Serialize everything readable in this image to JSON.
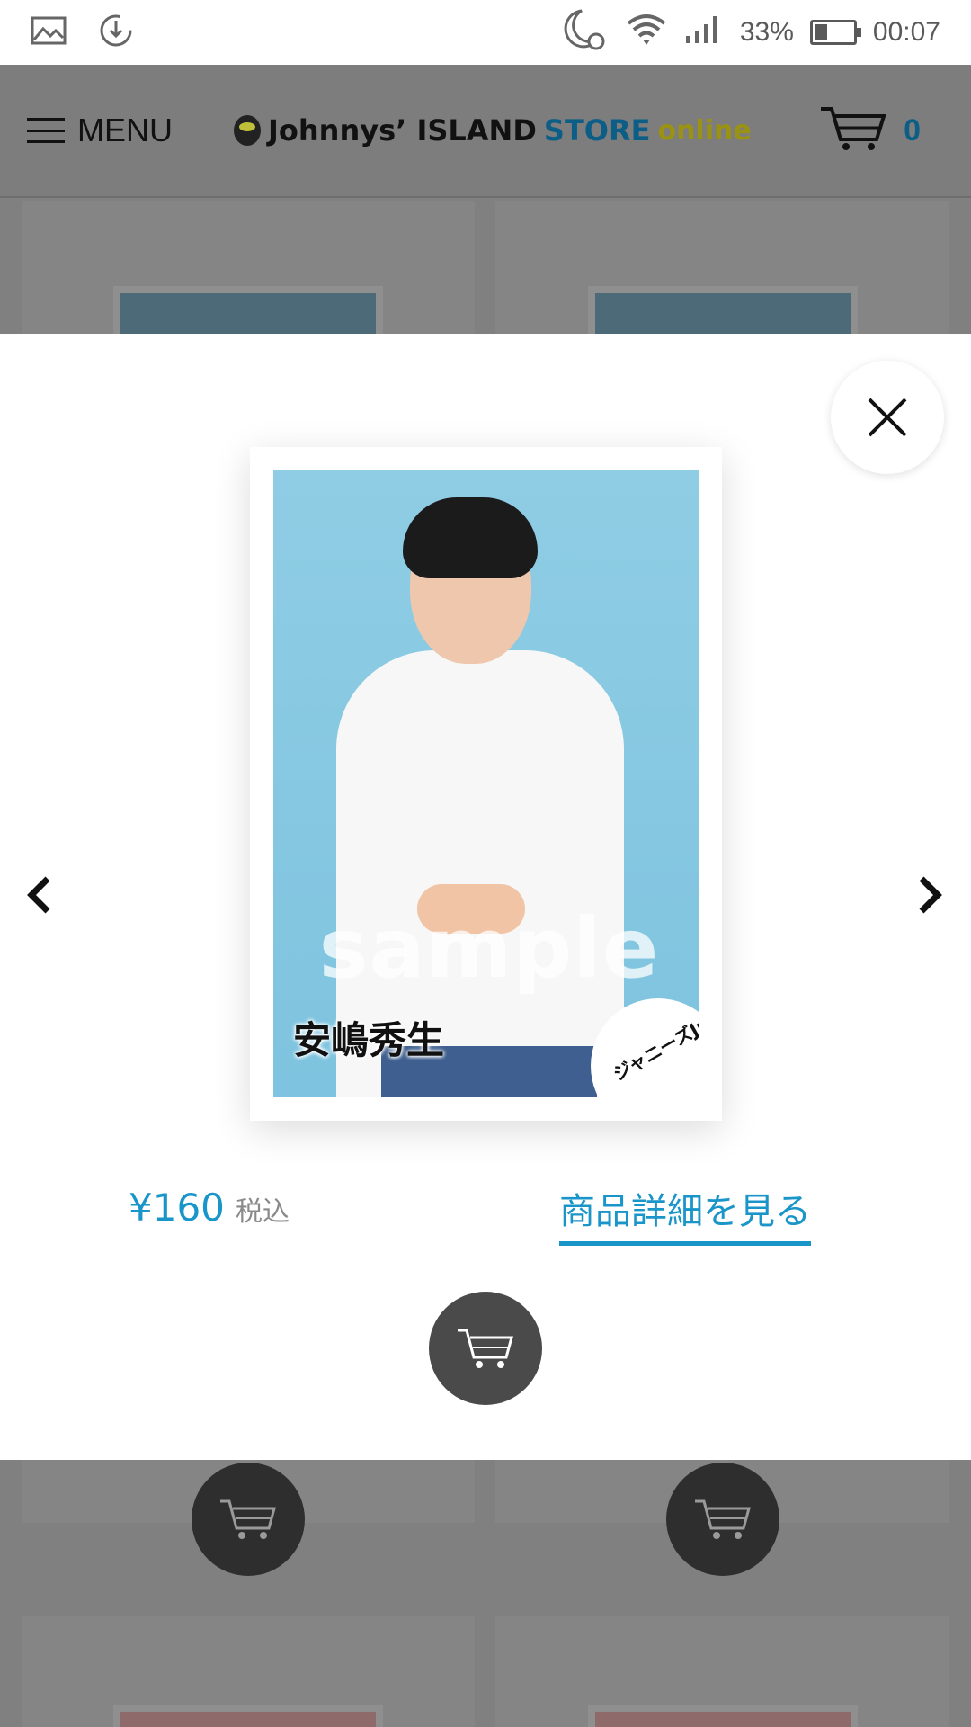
{
  "status_bar": {
    "battery": "33%",
    "battery_level": 0.33,
    "time": "00:07",
    "icons": [
      "gallery-icon",
      "sync-icon",
      "do-not-disturb-alarm-icon",
      "wifi-icon",
      "signal-icon",
      "battery-icon"
    ]
  },
  "header": {
    "menu_label": "MENU",
    "logo": {
      "part1": "Johnnys’ ISLAND",
      "part2": "STORE",
      "part3": "online"
    },
    "cart_count": "0"
  },
  "modal": {
    "photo": {
      "watermark": "sample",
      "name": "安嶋秀生",
      "corner_logo": "ジャニーズJr."
    },
    "price": "¥160",
    "price_tax": "税込",
    "detail_link": "商品詳細を見る"
  },
  "colors": {
    "accent": "#1a95c9",
    "overlay_dim": "#808080",
    "cart_button": "#4a4a4a"
  }
}
